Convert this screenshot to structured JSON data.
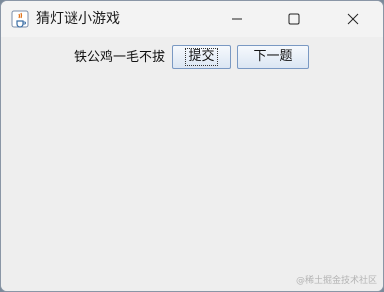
{
  "window": {
    "title": "猜灯谜小游戏",
    "controls": [
      "minimize-icon",
      "maximize-icon",
      "close-icon"
    ]
  },
  "main": {
    "riddle_text": "铁公鸡一毛不拔",
    "submit_label": "提交",
    "next_label": "下一题"
  },
  "watermark": "@稀土掘金技术社区",
  "colors": {
    "window_bg": "#f0f0f0",
    "button_border": "#7a99c3",
    "button_gradient_top": "#f6f9fd",
    "button_gradient_bottom": "#dbe6f3"
  }
}
